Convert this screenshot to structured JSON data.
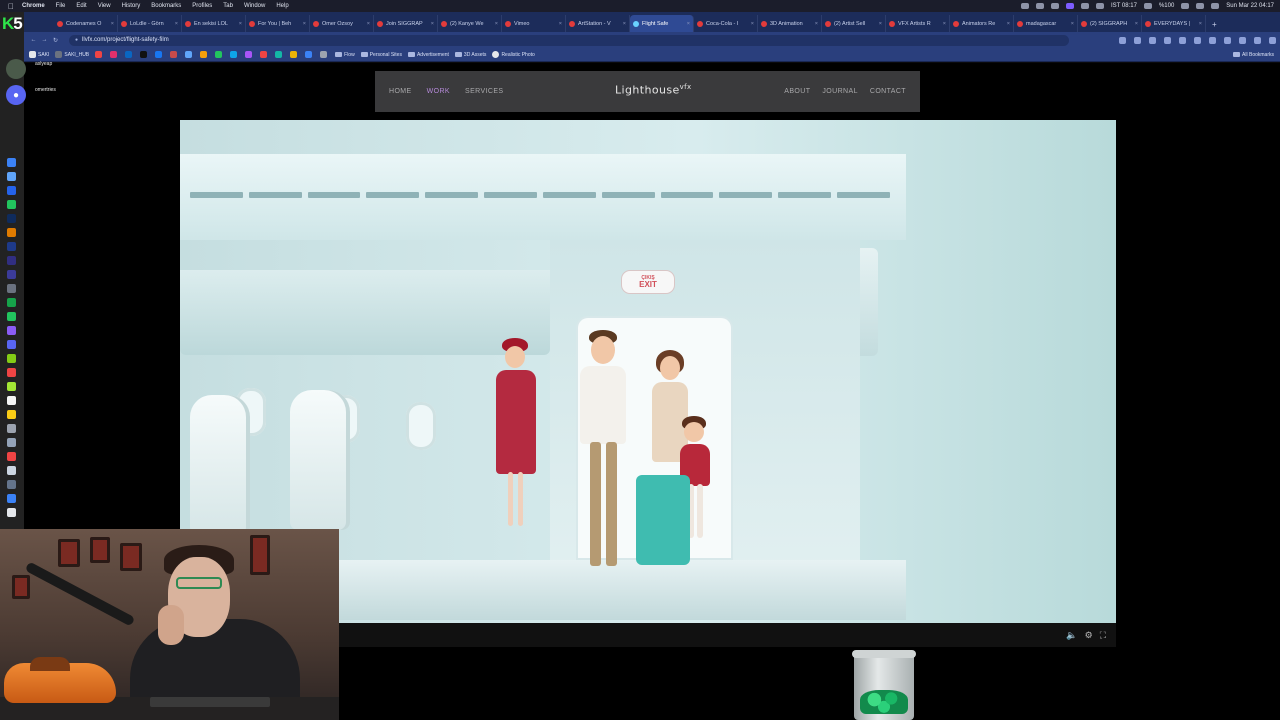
{
  "menubar": {
    "items": [
      "Chrome",
      "File",
      "Edit",
      "View",
      "History",
      "Bookmarks",
      "Profiles",
      "Tab",
      "Window",
      "Help"
    ],
    "battery": "%100",
    "clock": "Sun Mar 22  04:17",
    "tz_time": "IST 08:17"
  },
  "tabs": [
    {
      "label": "Codenames O"
    },
    {
      "label": "LoLdle - Görn"
    },
    {
      "label": "En sekisi LOL"
    },
    {
      "label": "For You | Beh"
    },
    {
      "label": "Omer Ozsoy"
    },
    {
      "label": "Join SIGGRAP"
    },
    {
      "label": "(2) Kanye We"
    },
    {
      "label": "Vimeo"
    },
    {
      "label": "ArtStation - V"
    },
    {
      "label": "Flight Safe"
    },
    {
      "label": "Coca-Cola - I"
    },
    {
      "label": "3D Animation"
    },
    {
      "label": "(2) Artist Sell"
    },
    {
      "label": "VFX Artists R"
    },
    {
      "label": "Animators Re"
    },
    {
      "label": "madagascar"
    },
    {
      "label": "(2) SIGGRAPH"
    },
    {
      "label": "EVERYDAYS |"
    }
  ],
  "active_tab_index": 9,
  "address": {
    "url": "llvfx.com/project/flight-safety-film"
  },
  "bookmarks": {
    "items": [
      "SAKI",
      "SAKI_HUB"
    ],
    "folders": [
      "Flow",
      "Personal Sites",
      "Advertisement",
      "3D Assets",
      "Realistic Photo"
    ],
    "all_label": "All Bookmarks"
  },
  "leftcol": {
    "users": [
      {
        "name": "aslyeap"
      },
      {
        "name": "omertries"
      }
    ]
  },
  "site": {
    "nav_left": [
      "HOME",
      "WORK",
      "SERVICES"
    ],
    "active_nav": "WORK",
    "logo": "Lighthouse",
    "logo_sup": "vfx",
    "nav_right": [
      "ABOUT",
      "JOURNAL",
      "CONTACT"
    ]
  },
  "hero": {
    "exit_sign_top": "ÇIKIŞ",
    "exit_sign_bottom": "EXIT"
  },
  "colors": {
    "accent_nav": "#b58ad9",
    "tab_bg": "#1c2c5a",
    "chrome_bg": "#2a3f7d",
    "exit_red": "#d14f59"
  }
}
